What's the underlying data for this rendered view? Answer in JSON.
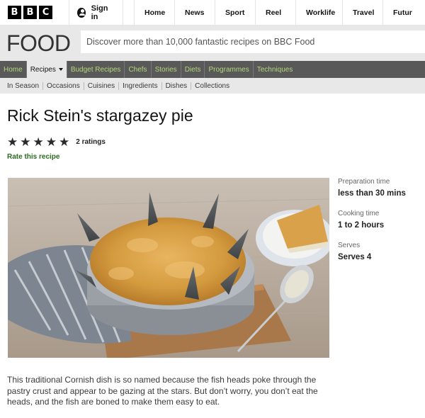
{
  "bbc_logo": [
    "B",
    "B",
    "C"
  ],
  "signin": {
    "label": "Sign in",
    "icon": "user-icon"
  },
  "top_nav": [
    "Home",
    "News",
    "Sport",
    "Reel",
    "Worklife",
    "Travel",
    "Futur"
  ],
  "food": {
    "logo": "FOOD",
    "search_placeholder": "Discover more than 10,000 fantastic recipes on BBC Food"
  },
  "primary_nav": [
    {
      "label": "Home",
      "active": false
    },
    {
      "label": "Recipes",
      "active": true
    },
    {
      "label": "Budget Recipes",
      "active": false
    },
    {
      "label": "Chefs",
      "active": false
    },
    {
      "label": "Stories",
      "active": false
    },
    {
      "label": "Diets",
      "active": false
    },
    {
      "label": "Programmes",
      "active": false
    },
    {
      "label": "Techniques",
      "active": false
    }
  ],
  "secondary_nav": [
    "In Season",
    "Occasions",
    "Cuisines",
    "Ingredients",
    "Dishes",
    "Collections"
  ],
  "recipe": {
    "title": "Rick Stein's stargazey pie",
    "stars": 5,
    "rating_count": "2 ratings",
    "rate_link": "Rate this recipe",
    "description": "This traditional Cornish dish is so named because the fish heads poke through the pastry crust and appear to be gazing at the stars. But don’t worry, you don’t eat the heads, and the fish are boned to make them easy to eat."
  },
  "details": [
    {
      "label": "Preparation time",
      "value": "less than 30 mins"
    },
    {
      "label": "Cooking time",
      "value": "1 to 2 hours"
    },
    {
      "label": "Serves",
      "value": "Serves 4"
    }
  ],
  "colors": {
    "nav_green": "#b3d67a",
    "nav_bg": "#595959",
    "rate_link": "#2b6b1f"
  }
}
